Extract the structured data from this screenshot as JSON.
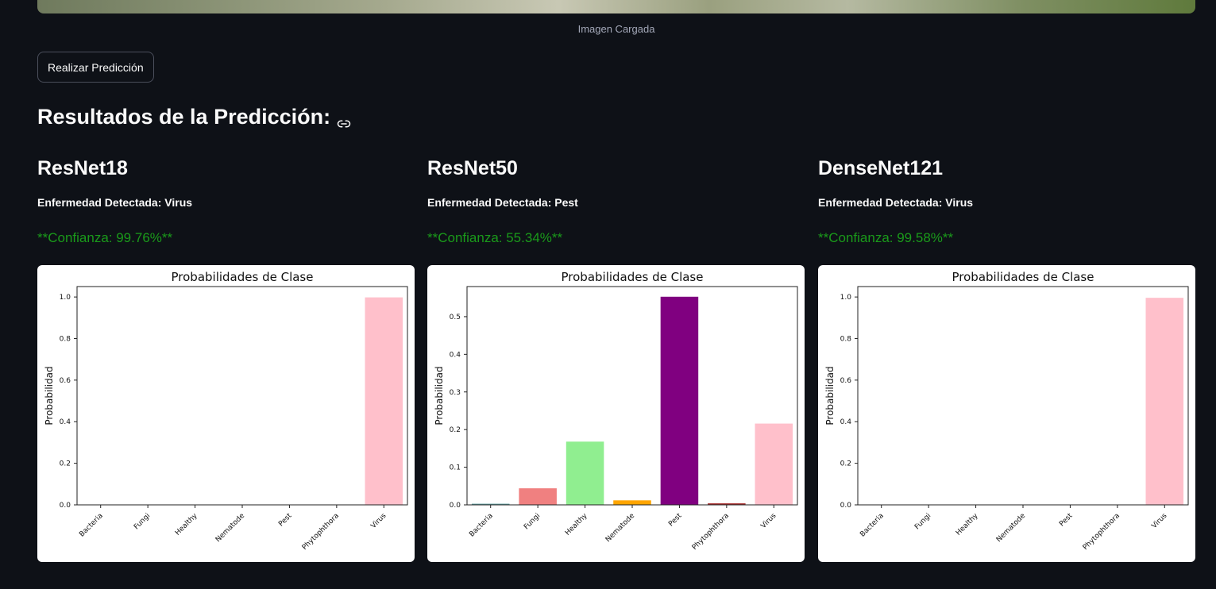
{
  "image_caption": "Imagen Cargada",
  "predict_button": "Realizar Predicción",
  "results_title": "Resultados de la Predicción:",
  "models": [
    {
      "name": "ResNet18",
      "disease": "Enfermedad Detectada: Virus",
      "confidence": "**Confianza: 99.76%**"
    },
    {
      "name": "ResNet50",
      "disease": "Enfermedad Detectada: Pest",
      "confidence": "**Confianza: 55.34%**"
    },
    {
      "name": "DenseNet121",
      "disease": "Enfermedad Detectada: Virus",
      "confidence": "**Confianza: 99.58%**"
    }
  ],
  "colors": {
    "background": "#0e1117",
    "confidence_text": "#1a9a1a",
    "bar_colors": [
      "#5f9ea0",
      "#f08080",
      "#90ee90",
      "#ffa500",
      "#800080",
      "#a52a2a",
      "#ffc0cb"
    ]
  },
  "chart_data": [
    {
      "type": "bar",
      "title": "Probabilidades de Clase",
      "ylabel": "Probabilidad",
      "xlabel": "",
      "categories": [
        "Bacteria",
        "Fungi",
        "Healthy",
        "Nematode",
        "Pest",
        "Phytophthora",
        "Virus"
      ],
      "values": [
        0.0,
        0.0,
        0.0,
        0.0,
        0.0,
        0.0,
        0.998
      ],
      "ylim": [
        0,
        1.05
      ],
      "yticks": [
        "0.0",
        "0.2",
        "0.4",
        "0.6",
        "0.8",
        "1.0"
      ]
    },
    {
      "type": "bar",
      "title": "Probabilidades de Clase",
      "ylabel": "Probabilidad",
      "xlabel": "",
      "categories": [
        "Bacteria",
        "Fungi",
        "Healthy",
        "Nematode",
        "Pest",
        "Phytophthora",
        "Virus"
      ],
      "values": [
        0.003,
        0.044,
        0.168,
        0.012,
        0.553,
        0.004,
        0.216
      ],
      "ylim": [
        0,
        0.58
      ],
      "yticks": [
        "0.0",
        "0.1",
        "0.2",
        "0.3",
        "0.4",
        "0.5"
      ]
    },
    {
      "type": "bar",
      "title": "Probabilidades de Clase",
      "ylabel": "Probabilidad",
      "xlabel": "",
      "categories": [
        "Bacteria",
        "Fungi",
        "Healthy",
        "Nematode",
        "Pest",
        "Phytophthora",
        "Virus"
      ],
      "values": [
        0.0,
        0.0,
        0.0,
        0.0,
        0.0,
        0.0,
        0.996
      ],
      "ylim": [
        0,
        1.05
      ],
      "yticks": [
        "0.0",
        "0.2",
        "0.4",
        "0.6",
        "0.8",
        "1.0"
      ]
    }
  ]
}
